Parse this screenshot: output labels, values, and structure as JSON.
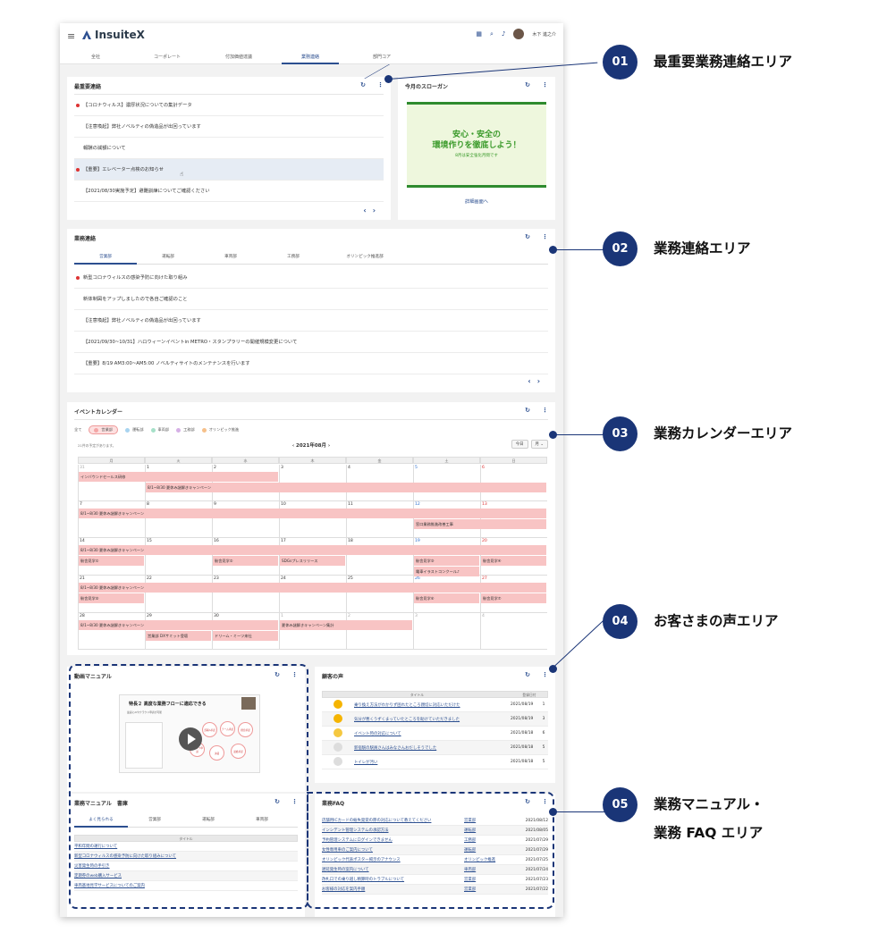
{
  "app": {
    "name": "InsuiteX",
    "user_name": "木下 進之介"
  },
  "nav_tabs": [
    "全社",
    "コーポレート",
    "付加価値達議",
    "業務連絡",
    "部門コア"
  ],
  "urgent": {
    "title": "最重要連絡",
    "items": [
      {
        "text": "【コロナウィルス】濃厚状況についての集計データ",
        "dot": true
      },
      {
        "text": "【注意喚起】弊社ノベルティの偽造品が出回っています",
        "dot": false
      },
      {
        "text": "報酬の減額について",
        "dot": false
      },
      {
        "text": "【重要】エレベーター点検のお知らせ",
        "dot": true
      },
      {
        "text": "【2021/08/30実施予定】避難訓練についてご確認ください",
        "dot": false
      }
    ]
  },
  "slogan": {
    "title": "今月のスローガン",
    "line1": "安心・安全の",
    "line2": "環境作りを徹底しよう！",
    "line3": "8月は安全強化月間です",
    "link": "詳細画面へ"
  },
  "business": {
    "title": "業務連絡",
    "tabs": [
      "営業部",
      "運転部",
      "車両部",
      "工務部",
      "オリンピック推進部"
    ],
    "items": [
      {
        "text": "新型コロナウィルスの感染予防に向けた取り組み",
        "dot": true
      },
      {
        "text": "新体制図をアップしましたので各自ご確認のこと",
        "dot": false
      },
      {
        "text": "【注意喚起】弊社ノベルティの偽造品が出回っています",
        "dot": false
      },
      {
        "text": "【2021/09/30~10/31】ハロウィーンイベントin METRO・スタンプラリーの開催規模変更について",
        "dot": false
      },
      {
        "text": "【重要】8/19 AM3:00~AM5:00 ノベルティサイトのメンテナンスを行います",
        "dot": false
      }
    ]
  },
  "calendar": {
    "title": "イベントカレンダー",
    "legend_all": "全て",
    "legend": [
      {
        "label": "営業部",
        "color": "#f4a6a6"
      },
      {
        "label": "運転部",
        "color": "#a8d4f0"
      },
      {
        "label": "車両部",
        "color": "#a6e0c8"
      },
      {
        "label": "工務部",
        "color": "#d6b0e6"
      },
      {
        "label": "オリンピック推進",
        "color": "#f6c08a"
      }
    ],
    "note": "21件の予定があります。",
    "month": "‹ 2021年08月 ›",
    "today_btn": "今日",
    "view_btn": "月 ⌄",
    "weekdays": [
      "月",
      "火",
      "水",
      "木",
      "金",
      "土",
      "日"
    ],
    "weeks": [
      [
        "31",
        "1",
        "2",
        "3",
        "4",
        "5",
        "6"
      ],
      [
        "7",
        "8",
        "9",
        "10",
        "11",
        "12",
        "13"
      ],
      [
        "14",
        "15",
        "16",
        "17",
        "18",
        "19",
        "20"
      ],
      [
        "21",
        "22",
        "23",
        "24",
        "25",
        "26",
        "27"
      ],
      [
        "28",
        "29",
        "30",
        "1",
        "2",
        "3",
        "4"
      ]
    ],
    "events": {
      "e1": "インバウンドセールス研修",
      "e2": "8/1~8/30 夏休み謎解きキャンペーン",
      "e3": "8/1~8/30 夏休み謎解きキャンペーン",
      "e4": "窓口業務推進改善工事",
      "e5": "8/1~8/30 夏休み謎解きキャンペーン",
      "e6": "駅舎見学①",
      "e7": "駅舎見学②",
      "e8": "SDGsプレスリリース",
      "e9": "駅舎見学③",
      "e10": "駅舎見学④",
      "e11": "電車イラストコンクール♪",
      "e12": "8/1~8/30 夏休み謎解きキャンペーン",
      "e13": "駅舎見学⑤",
      "e14": "駅舎見学⑥",
      "e15": "駅舎見学⑦",
      "e16": "8/1~8/30 夏休み謎解きキャンペーン",
      "e17": "夏休み謎解きキャンペーン集計",
      "e18": "営業部 DXサミット登壇",
      "e19": "ドリーム・ミーツ来社"
    }
  },
  "video": {
    "title": "動画マニュアル",
    "heading": "特長２ 高度な業務フローに適応できる",
    "sub": "稟議にAIやクラウド申請が可能",
    "bubbles": [
      "部署A承認",
      "チーム承認",
      "経営承認",
      "経理承認",
      "スタッフ申請",
      "決裁",
      "最終承認"
    ]
  },
  "voice": {
    "title": "顧客の声",
    "col_title": "タイトル",
    "col_date": "登録日付",
    "rows": [
      {
        "text": "乗り換え方法がわかりず困れたところ親切に対応いただけた",
        "date": "2021/08/19",
        "count": "1"
      },
      {
        "text": "気分が悪くうずくまっていたところを助けていただきました",
        "date": "2021/08/19",
        "count": "3"
      },
      {
        "text": "イベント時の対応について",
        "date": "2021/08/18",
        "count": "6"
      },
      {
        "text": "新宿駅の駅員さんはみなさんおだしそうでした",
        "date": "2021/08/18",
        "count": "5"
      },
      {
        "text": "トイレが汚い",
        "date": "2021/08/18",
        "count": "5"
      }
    ]
  },
  "manual": {
    "title": "業務マニュアル　書庫",
    "tabs": [
      "よく見られる",
      "営業部",
      "運転部",
      "車両部"
    ],
    "col_title": "タイトル",
    "rows": [
      "平和年間の運行について",
      "新型コロナウィルスの感染予防に向けた取り組みについて",
      "災害発生時の手引き",
      "定期券のweb購入サービス",
      "車両基地見学サービスについてのご案内"
    ]
  },
  "faq": {
    "title": "業務FAQ",
    "rows": [
      {
        "q": "店舗用ICカードの紛失発覚の際の対応について教えてください",
        "dept": "営業部",
        "date": "2021/08/12"
      },
      {
        "q": "インシデント管理システムの承認方法",
        "dept": "運転部",
        "date": "2021/08/05"
      },
      {
        "q": "予約管理システムにログインできません",
        "dept": "工務部",
        "date": "2021/07/29"
      },
      {
        "q": "女性専用車のご案内について",
        "dept": "運転部",
        "date": "2021/07/29"
      },
      {
        "q": "オリンピック代表ポスター掲示のアナウンス",
        "dept": "オリンピック推進",
        "date": "2021/07/25"
      },
      {
        "q": "遅延発生時の案内について",
        "dept": "車両部",
        "date": "2021/07/24"
      },
      {
        "q": "改札口での乗り越し精算時のトラブルについて",
        "dept": "営業部",
        "date": "2021/07/23"
      },
      {
        "q": "お客様の対応を案内手順",
        "dept": "営業部",
        "date": "2021/07/22"
      }
    ]
  },
  "callouts": [
    {
      "num": "01",
      "label": "最重要業務連絡エリア"
    },
    {
      "num": "02",
      "label": "業務連絡エリア"
    },
    {
      "num": "03",
      "label": "業務カレンダーエリア"
    },
    {
      "num": "04",
      "label": "お客さまの声エリア"
    },
    {
      "num": "05",
      "label": "業務マニュアル・",
      "label2": "業務 FAQ エリア"
    }
  ]
}
